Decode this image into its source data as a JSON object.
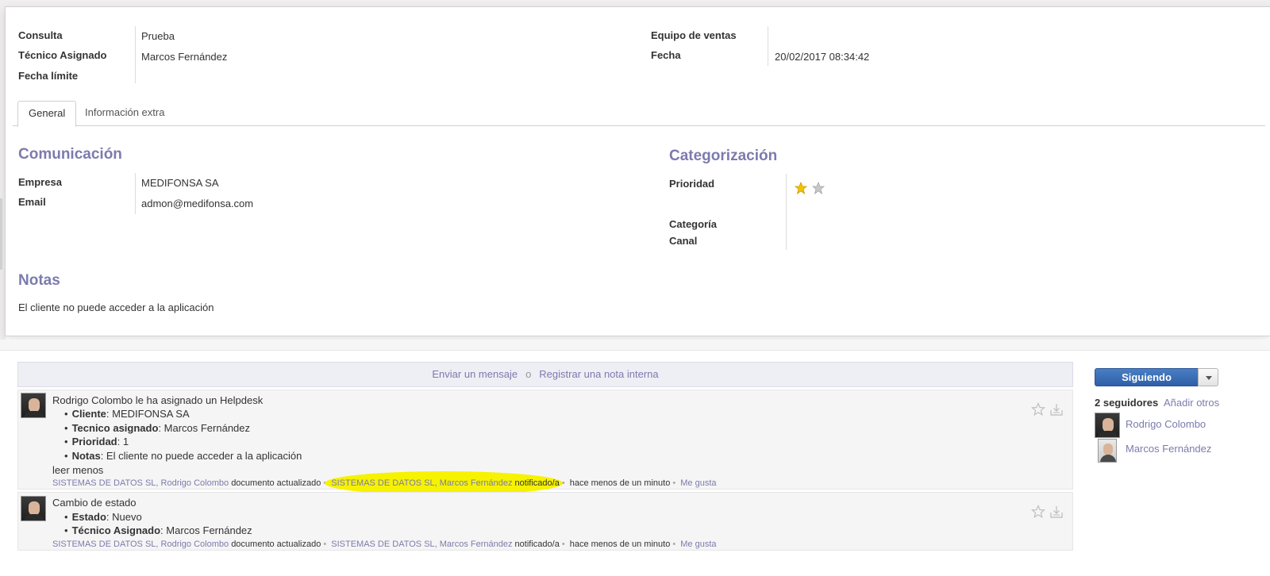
{
  "header_fields": {
    "consulta_label": "Consulta",
    "consulta_value": "Prueba",
    "tecnico_label": "Técnico Asignado",
    "tecnico_value": "Marcos Fernández",
    "fecha_limite_label": "Fecha límite",
    "equipo_label": "Equipo de ventas",
    "fecha_label": "Fecha",
    "fecha_value": "20/02/2017 08:34:42"
  },
  "tabs": [
    {
      "label": "General",
      "active": true
    },
    {
      "label": "Información extra",
      "active": false
    }
  ],
  "comunicacion": {
    "title": "Comunicación",
    "empresa_label": "Empresa",
    "empresa_value": "MEDIFONSA SA",
    "email_label": "Email",
    "email_value": "admon@medifonsa.com"
  },
  "categorizacion": {
    "title": "Categorización",
    "prioridad_label": "Prioridad",
    "prioridad_stars": 1,
    "prioridad_max": 2,
    "categoria_label": "Categoría",
    "canal_label": "Canal"
  },
  "notas": {
    "title": "Notas",
    "text": "El cliente no puede acceder a la aplicación"
  },
  "composer": {
    "send_message": "Enviar un mensaje",
    "separator": "o",
    "log_note": "Registrar una nota interna"
  },
  "messages": [
    {
      "title": "Rodrigo Colombo le ha asignado un Helpdesk",
      "lines": [
        {
          "key": "Cliente",
          "value": ": MEDIFONSA SA"
        },
        {
          "key": "Tecnico asignado",
          "value": ": Marcos Fernández"
        },
        {
          "key": "Prioridad",
          "value": ": 1"
        },
        {
          "key": "Notas",
          "value": ": El cliente no puede acceder a la aplicación"
        }
      ],
      "read_less": "leer menos",
      "author": "SISTEMAS DE DATOS SL, Rodrigo Colombo",
      "action": "documento actualizado",
      "notified": "SISTEMAS DE DATOS SL, Marcos Fernández",
      "notified_suffix": "notificado/a",
      "time": "hace menos de un minuto",
      "like": "Me gusta"
    },
    {
      "title": "Cambio de estado",
      "lines": [
        {
          "key": "Estado",
          "value": ": Nuevo"
        },
        {
          "key": "Técnico Asignado",
          "value": ": Marcos Fernández"
        }
      ],
      "author": "SISTEMAS DE DATOS SL, Rodrigo Colombo",
      "action": "documento actualizado",
      "notified": "SISTEMAS DE DATOS SL, Marcos Fernández",
      "notified_suffix": "notificado/a",
      "time": "hace menos de un minuto",
      "like": "Me gusta"
    }
  ],
  "followers": {
    "button_label": "Siguiendo",
    "count_label": "2 seguidores",
    "add_label": "Añadir otros",
    "list": [
      "Rodrigo Colombo",
      "Marcos Fernández"
    ]
  },
  "colors": {
    "accent": "#7c7bad",
    "button_blue": "#2e5fa8",
    "star_gold": "#f3c300",
    "highlight": "#f6f200"
  }
}
